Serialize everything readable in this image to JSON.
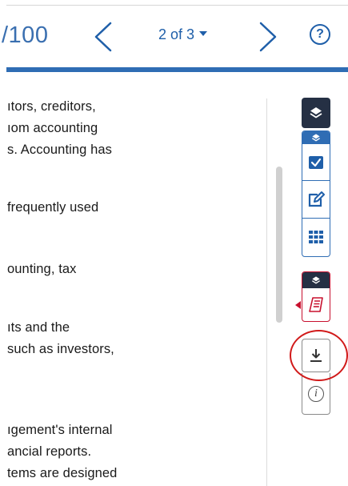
{
  "header": {
    "score_text": "/100",
    "page_indicator": "2 of 3",
    "help_label": "?"
  },
  "content": {
    "lines": [
      "ıtors, creditors,",
      "ıom accounting",
      "s. Accounting has",
      "frequently used",
      "ounting, tax",
      "ıts and the",
      "such as investors,",
      "ıgement's internal",
      "ancial reports.",
      "tems are designed"
    ]
  },
  "toolbar": {
    "items": [
      {
        "name": "layers",
        "icon": "layers-icon"
      },
      {
        "name": "checkbox",
        "icon": "checkbox-icon"
      },
      {
        "name": "edit",
        "icon": "edit-icon"
      },
      {
        "name": "grid",
        "icon": "grid-icon"
      },
      {
        "name": "receipt",
        "icon": "receipt-icon"
      },
      {
        "name": "download",
        "icon": "download-icon"
      },
      {
        "name": "info",
        "icon": "info-icon",
        "label": "i"
      }
    ]
  },
  "colors": {
    "accent": "#2f6db4",
    "dark": "#253044",
    "alert": "#c8102e"
  }
}
